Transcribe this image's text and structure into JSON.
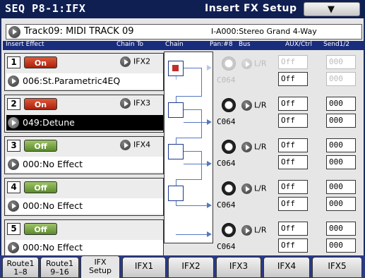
{
  "header": {
    "mode": "SEQ P8-1:IFX",
    "page_title": "Insert FX Setup",
    "menu_icon": "chevron-down-icon"
  },
  "track": {
    "name": "Track09: MIDI TRACK 09",
    "program": "I-A000:Stereo Grand 4-Way"
  },
  "columns": {
    "insert_effect": "Insert Effect",
    "chain_to": "Chain To",
    "chain": "Chain",
    "pan": "Pan:#8",
    "bus": "Bus",
    "aux_ctrl": "AUX/Ctrl",
    "send": "Send1/2"
  },
  "slots": [
    {
      "num": "1",
      "state": "On",
      "chain_to": "IFX2",
      "effect": "006:St.Parametric4EQ",
      "pan": "C064",
      "bus": "L/R",
      "aux": "Off",
      "ctrl": "Off",
      "send1": "000",
      "send2": "000"
    },
    {
      "num": "2",
      "state": "On",
      "chain_to": "IFX3",
      "effect": "049:Detune",
      "pan": "C064",
      "bus": "L/R",
      "aux": "Off",
      "ctrl": "Off",
      "send1": "000",
      "send2": "000"
    },
    {
      "num": "3",
      "state": "Off",
      "chain_to": "IFX4",
      "effect": "000:No Effect",
      "pan": "C064",
      "bus": "L/R",
      "aux": "Off",
      "ctrl": "Off",
      "send1": "000",
      "send2": "000"
    },
    {
      "num": "4",
      "state": "Off",
      "chain_to": "",
      "effect": "000:No Effect",
      "pan": "C064",
      "bus": "L/R",
      "aux": "Off",
      "ctrl": "Off",
      "send1": "000",
      "send2": "000"
    },
    {
      "num": "5",
      "state": "Off",
      "chain_to": "",
      "effect": "000:No Effect",
      "pan": "C064",
      "bus": "L/R",
      "aux": "Off",
      "ctrl": "Off",
      "send1": "000",
      "send2": "000"
    }
  ],
  "tabs": [
    {
      "line1": "Route1",
      "line2": "1–8"
    },
    {
      "line1": "Route1",
      "line2": "9–16"
    },
    {
      "line1": "IFX",
      "line2": "Setup"
    },
    {
      "line1": "IFX1",
      "line2": ""
    },
    {
      "line1": "IFX2",
      "line2": ""
    },
    {
      "line1": "IFX3",
      "line2": ""
    },
    {
      "line1": "IFX4",
      "line2": ""
    },
    {
      "line1": "IFX5",
      "line2": ""
    }
  ],
  "colors": {
    "header_bg": "#0f1f52",
    "tab_bar_bg": "#2a3a8a",
    "on_button": "#c0301a",
    "off_button": "#7aa84a",
    "chain_active": "#c0302a"
  }
}
